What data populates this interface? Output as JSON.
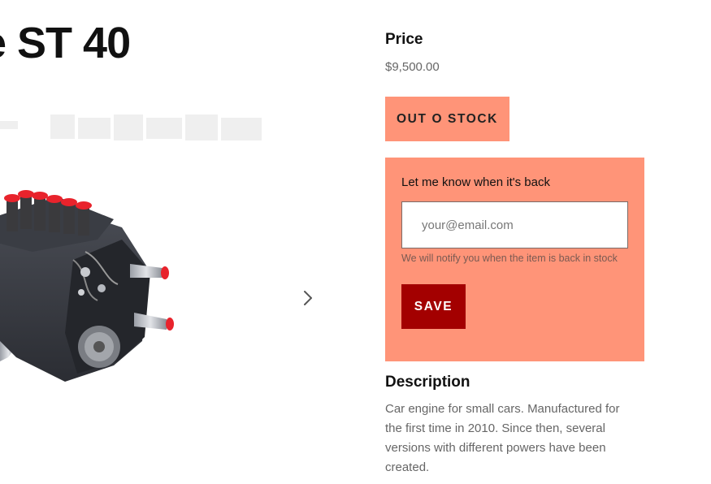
{
  "product": {
    "title_visible": "e ST 40",
    "image_icon": "car-engine-image"
  },
  "gallery": {
    "next_icon": "chevron-right-icon"
  },
  "price": {
    "heading": "Price",
    "value": "$9,500.00"
  },
  "stock": {
    "button_label": "OUT O STOCK"
  },
  "notify": {
    "label": "Let me know when it's back",
    "email_placeholder": "your@email.com",
    "hint": "We will notify you when the item is back in stock",
    "save_label": "SAVE"
  },
  "description": {
    "heading": "Description",
    "text": "Car engine for small cars. Manufactured for the first time in 2010. Since then, several versions with different powers have been created."
  },
  "colors": {
    "accent_salmon": "#ff9478",
    "save_red": "#a30000",
    "engine_intake_red": "#e8232c"
  }
}
